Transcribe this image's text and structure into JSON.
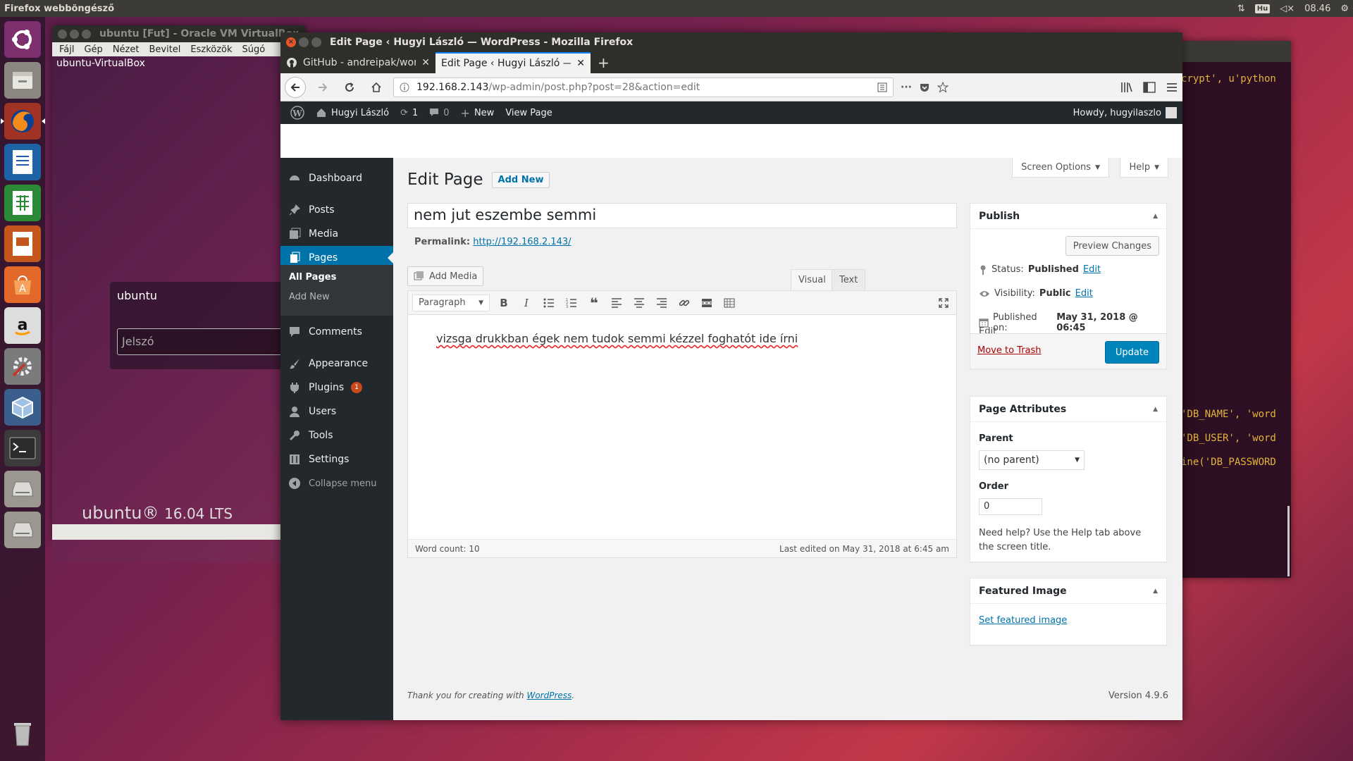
{
  "topbar": {
    "title": "Firefox webböngésző",
    "keyboard": "Hu",
    "time": "08.46"
  },
  "launcher": {
    "items": [
      "ubuntu-logo-icon",
      "files-icon",
      "firefox-icon",
      "writer-icon",
      "calc-icon",
      "impress-icon",
      "software-center-icon",
      "amazon-icon",
      "system-settings-icon",
      "virtualbox-icon",
      "terminal-icon",
      "drive-icon",
      "drive-icon",
      "trash-icon"
    ]
  },
  "virtualbox": {
    "title": "ubuntu [Fut] - Oracle VM VirtualBox",
    "menu": [
      "Fájl",
      "Gép",
      "Nézet",
      "Bevitel",
      "Eszközök",
      "Súgó"
    ],
    "hostname": "ubuntu-VirtualBox",
    "login_user": "ubuntu",
    "password_placeholder": "Jelszó",
    "brand": "ubuntu®",
    "version": "16.04 LTS"
  },
  "terminal": {
    "lines": [
      "crypt', u'python",
      "'DB_NAME', 'word",
      "'DB_USER', 'word",
      "ine('DB_PASSWORD"
    ]
  },
  "firefox": {
    "window_title": "Edit Page ‹ Hugyi László — WordPress - Mozilla Firefox",
    "tabs": [
      {
        "label": "GitHub - andreipak/wor",
        "active": false
      },
      {
        "label": "Edit Page ‹ Hugyi László — V",
        "active": true
      }
    ],
    "new_tab": "+",
    "url_host": "192.168.2.143",
    "url_path": "/wp-admin/post.php?post=28&action=edit",
    "url_more": "···"
  },
  "adminbar": {
    "site_name": "Hugyi László",
    "updates": "1",
    "comments": "0",
    "new": "New",
    "view_page": "View Page",
    "howdy": "Howdy, hugyilaszlo"
  },
  "sidebar": {
    "dashboard": "Dashboard",
    "posts": "Posts",
    "media": "Media",
    "pages": "Pages",
    "all_pages": "All Pages",
    "add_new": "Add New",
    "comments": "Comments",
    "appearance": "Appearance",
    "plugins": "Plugins",
    "plugins_badge": "1",
    "users": "Users",
    "tools": "Tools",
    "settings": "Settings",
    "collapse": "Collapse menu"
  },
  "screen": {
    "screen_options": "Screen Options",
    "help": "Help",
    "heading": "Edit Page",
    "add_new": "Add New",
    "post_title": "nem jut eszembe semmi",
    "permalink_label": "Permalink:",
    "permalink_url": "http://192.168.2.143/",
    "add_media": "Add Media",
    "tab_visual": "Visual",
    "tab_text": "Text",
    "format": "Paragraph",
    "content": "vizsga drukkban égek nem tudok semmi kézzel foghatót ide írni",
    "word_count": "Word count: 10",
    "last_edited": "Last edited on May 31, 2018 at 6:45 am",
    "footer_text": "Thank you for creating with",
    "footer_link": "WordPress",
    "version": "Version 4.9.6"
  },
  "publish": {
    "title": "Publish",
    "preview": "Preview Changes",
    "status_label": "Status:",
    "status_value": "Published",
    "visibility_label": "Visibility:",
    "visibility_value": "Public",
    "published_label": "Published on:",
    "published_value": "May 31, 2018 @ 06:45",
    "edit": "Edit",
    "trash": "Move to Trash",
    "update": "Update"
  },
  "page_attributes": {
    "title": "Page Attributes",
    "parent_label": "Parent",
    "parent_value": "(no parent)",
    "order_label": "Order",
    "order_value": "0",
    "help_text": "Need help? Use the Help tab above the screen title."
  },
  "featured_image": {
    "title": "Featured Image",
    "link": "Set featured image"
  }
}
